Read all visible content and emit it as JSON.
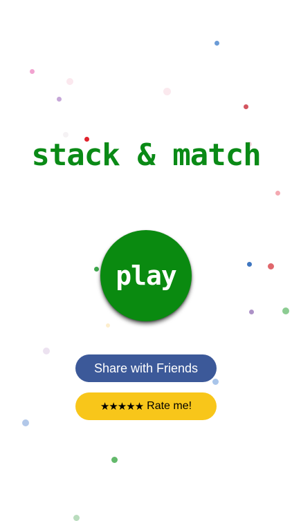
{
  "title": "stack & match",
  "play_label": "play",
  "share_label": "Share with Friends",
  "rate": {
    "stars": "★★★★★",
    "label": "Rate me!"
  },
  "colors": {
    "background": "#ffffff",
    "title_green": "#0a8a16",
    "play_green": "#0a8a10",
    "share_blue": "#3c5999",
    "rate_yellow": "#f8c61a"
  }
}
